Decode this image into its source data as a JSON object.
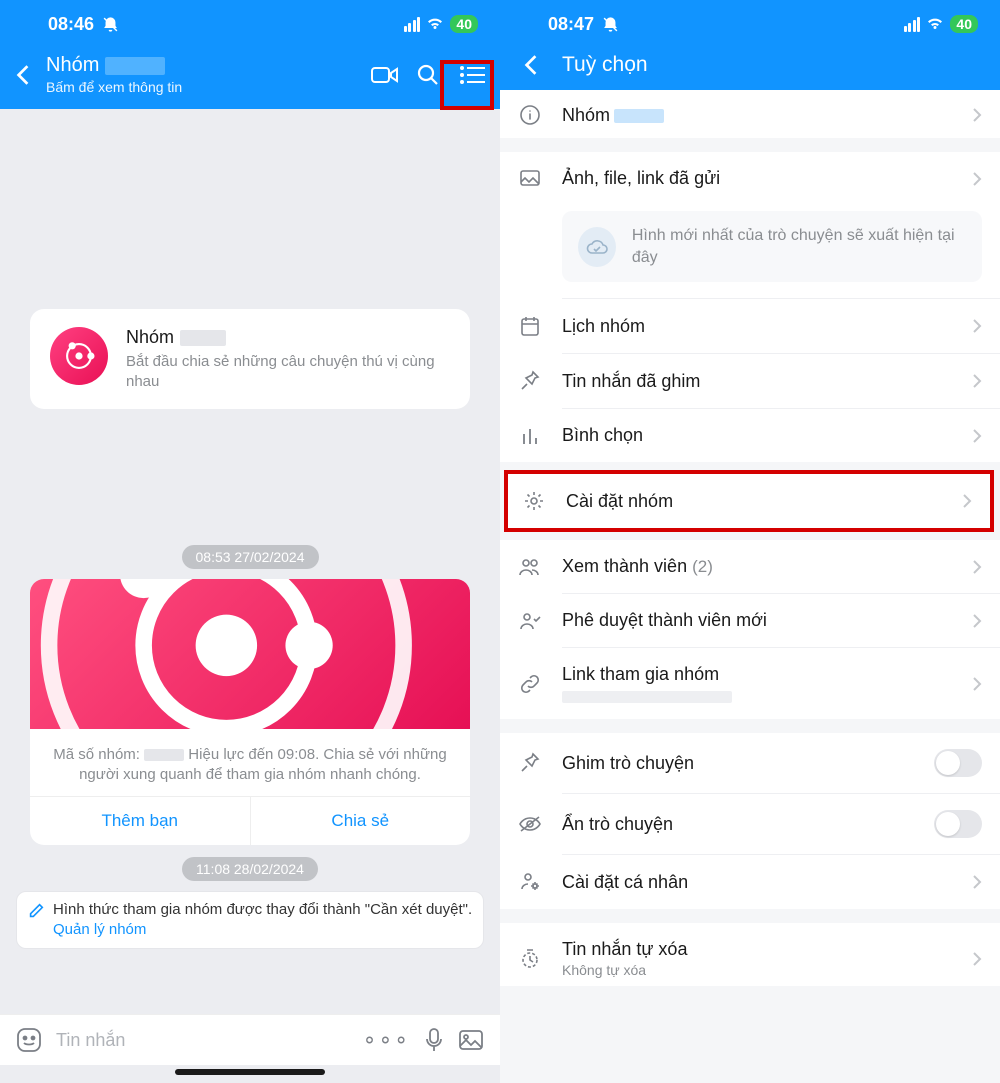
{
  "left": {
    "status": {
      "time": "08:46",
      "battery": "40"
    },
    "header": {
      "title": "Nhóm",
      "subtitle": "Bấm để xem thông tin"
    },
    "intro": {
      "title": "Nhóm",
      "desc": "Bắt đầu chia sẻ những câu chuyện thú vị cùng nhau"
    },
    "ts1": "08:53 27/02/2024",
    "mediaCard": {
      "text_pre": "Mã số nhóm: ",
      "text_post": " Hiệu lực đến 09:08. Chia sẻ với những người xung quanh để tham gia nhóm nhanh chóng.",
      "action1": "Thêm bạn",
      "action2": "Chia sẻ"
    },
    "ts2": "11:08 28/02/2024",
    "sysMsg": {
      "text": "Hình thức tham gia nhóm được thay đổi thành \"Cần xét duyệt\".",
      "link": "Quản lý nhóm"
    },
    "composer": {
      "placeholder": "Tin nhắn"
    }
  },
  "right": {
    "status": {
      "time": "08:47",
      "battery": "40"
    },
    "header": {
      "title": "Tuỳ chọn"
    },
    "rows": {
      "group_name": "Nhóm",
      "media": "Ảnh, file, link đã gửi",
      "media_hint": "Hình mới nhất của trò chuyện sẽ xuất hiện tại đây",
      "calendar": "Lịch nhóm",
      "pinned": "Tin nhắn đã ghim",
      "poll": "Bình chọn",
      "settings": "Cài đặt nhóm",
      "members_label": "Xem thành viên ",
      "members_count": "(2)",
      "approve": "Phê duyệt thành viên mới",
      "invite_label": "Link tham gia nhóm",
      "pin_chat": "Ghim trò chuyện",
      "hide_chat": "Ẩn trò chuyện",
      "personal": "Cài đặt cá nhân",
      "auto_del": "Tin nhắn tự xóa",
      "auto_del_sub": "Không tự xóa"
    }
  }
}
